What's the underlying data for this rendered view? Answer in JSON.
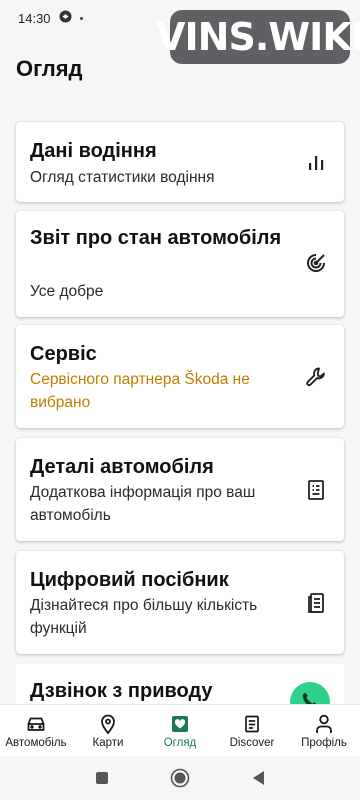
{
  "status_bar": {
    "time": "14:30"
  },
  "watermark": {
    "text": "VINS.WIKI"
  },
  "page": {
    "title": "Огляд"
  },
  "cards": [
    {
      "title": "Дані водіння",
      "subtitle": "Огляд статистики водіння",
      "icon": "bar-chart-icon"
    },
    {
      "title": "Звіт про стан автомобіля",
      "subtitle": "Усе добре",
      "icon": "radar-target-icon"
    },
    {
      "title": "Сервіс",
      "subtitle": "Сервісного партнера Škoda не вибрано",
      "icon": "wrench-icon"
    },
    {
      "title": "Деталі автомобіля",
      "subtitle": "Додаткова інформація про ваш автомобіль",
      "icon": "document-list-icon"
    },
    {
      "title": "Цифровий посібник",
      "subtitle": "Дізнайтеся про більшу кількість функцій",
      "icon": "manual-book-icon"
    }
  ],
  "partial_card": {
    "title": "Дзвінок з приводу"
  },
  "bottom_nav": {
    "items": [
      {
        "label": "Автомобіль",
        "icon": "car-icon"
      },
      {
        "label": "Карти",
        "icon": "map-pin-icon"
      },
      {
        "label": "Огляд",
        "icon": "heart-shield-icon",
        "active": true
      },
      {
        "label": "Discover",
        "icon": "news-icon"
      },
      {
        "label": "Профіль",
        "icon": "person-icon"
      }
    ]
  },
  "colors": {
    "accent": "#1f7a4f",
    "warning_text": "#c07d00",
    "fab": "#2fd08a",
    "background": "#f5f6f5"
  }
}
